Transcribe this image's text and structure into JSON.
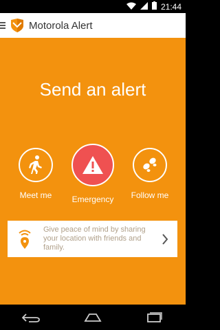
{
  "status_bar": {
    "time": "21:44",
    "icons": [
      "wifi-icon",
      "signal-icon",
      "battery-icon"
    ]
  },
  "app_bar": {
    "title": "Motorola Alert",
    "menu_icon": "hamburger-icon",
    "logo_icon": "motorola-alert-logo"
  },
  "main": {
    "headline": "Send an alert",
    "background_color": "#f3920e",
    "actions": [
      {
        "label": "Meet me",
        "icon": "walking-person-icon"
      },
      {
        "label": "Emergency",
        "icon": "warning-icon",
        "color": "#ef5151"
      },
      {
        "label": "Follow me",
        "icon": "footsteps-icon"
      }
    ]
  },
  "info_card": {
    "text": "Give peace of mind by sharing your location with friends and family.",
    "icon": "location-broadcast-icon",
    "chevron": "chevron-right-icon"
  },
  "nav_bar": {
    "buttons": [
      "back-icon",
      "home-icon",
      "recents-icon"
    ]
  }
}
